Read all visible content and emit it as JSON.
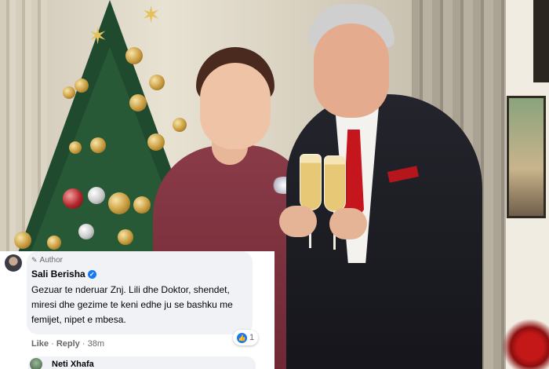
{
  "comment": {
    "author_tag": "Author",
    "name": "Sali Berisha",
    "text": "Gezuar te nderuar Znj. Lili dhe Doktor, shendet, miresi dhe gezime te keni edhe ju se bashku me femijet, nipet e mbesa.",
    "reaction_count": "1",
    "like_label": "Like",
    "separator": "·",
    "reply_label": "Reply",
    "time": "38m"
  },
  "next_comment": {
    "name": "Neti Xhafa"
  }
}
